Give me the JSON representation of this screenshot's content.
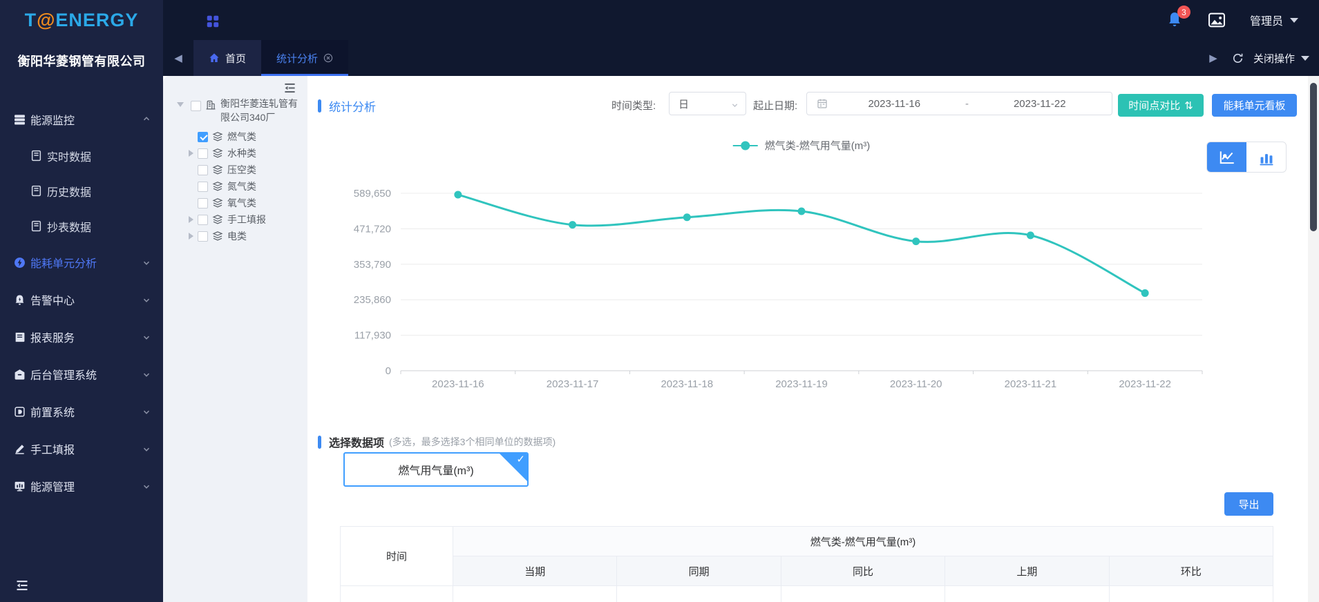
{
  "header": {
    "logo": {
      "t": "T",
      "at": "@",
      "rest": "ENERGY"
    },
    "company": "衡阳华菱钢管有限公司",
    "notification_badge": "3",
    "user": "管理员"
  },
  "tabbar": {
    "home_tab": "首页",
    "active_tab": "统计分析",
    "close_action": "关闭操作"
  },
  "sidebar": {
    "items": [
      {
        "label": "能源监控",
        "icon": "server-icon",
        "expanded": true,
        "active": false,
        "children": [
          {
            "label": "实时数据",
            "icon": "book-icon"
          },
          {
            "label": "历史数据",
            "icon": "book-icon"
          },
          {
            "label": "抄表数据",
            "icon": "book-icon"
          }
        ]
      },
      {
        "label": "能耗单元分析",
        "icon": "bolt-circle-icon",
        "expanded": false,
        "active": true,
        "children": []
      },
      {
        "label": "告警中心",
        "icon": "alarm-bell-icon",
        "expanded": false,
        "active": false,
        "children": []
      },
      {
        "label": "报表服务",
        "icon": "report-icon",
        "expanded": false,
        "active": false,
        "children": []
      },
      {
        "label": "后台管理系统",
        "icon": "safe-icon",
        "expanded": false,
        "active": false,
        "children": []
      },
      {
        "label": "前置系统",
        "icon": "front-system-icon",
        "expanded": false,
        "active": false,
        "children": []
      },
      {
        "label": "手工填报",
        "icon": "pencil-icon",
        "expanded": false,
        "active": false,
        "children": []
      },
      {
        "label": "能源管理",
        "icon": "monitor-chart-icon",
        "expanded": false,
        "active": false,
        "children": []
      }
    ]
  },
  "tree": {
    "root": {
      "label": "衡阳华菱连轧管有限公司340厂",
      "icon": "building-icon",
      "checked": false
    },
    "nodes": [
      {
        "label": "燃气类",
        "checked": true,
        "caret": "none"
      },
      {
        "label": "水种类",
        "checked": false,
        "caret": "right"
      },
      {
        "label": "压空类",
        "checked": false,
        "caret": "none"
      },
      {
        "label": "氮气类",
        "checked": false,
        "caret": "none"
      },
      {
        "label": "氧气类",
        "checked": false,
        "caret": "none"
      },
      {
        "label": "手工填报",
        "checked": false,
        "caret": "right"
      },
      {
        "label": "电类",
        "checked": false,
        "caret": "right"
      }
    ]
  },
  "toolbar": {
    "section_title": "统计分析",
    "time_type_label": "时间类型:",
    "time_type_value": "日",
    "date_range_label": "起止日期:",
    "date_start": "2023-11-16",
    "date_separator": "-",
    "date_end": "2023-11-22",
    "compare_button": "时间点对比",
    "compare_icon": "⇅",
    "board_button": "能耗单元看板"
  },
  "chart_data": {
    "type": "line",
    "smooth": true,
    "grid": true,
    "legend_position": "top-center",
    "x": [
      "2023-11-16",
      "2023-11-17",
      "2023-11-18",
      "2023-11-19",
      "2023-11-20",
      "2023-11-21",
      "2023-11-22"
    ],
    "series": [
      {
        "name": "燃气类-燃气用气量(m³)",
        "values": [
          585000,
          485000,
          510000,
          530000,
          430000,
          450000,
          258000
        ],
        "color": "#30c4be"
      }
    ],
    "ylim": [
      0,
      589650
    ],
    "yticks": [
      0,
      117930,
      235860,
      353790,
      471720,
      589650
    ],
    "ytick_labels": [
      "0",
      "117,930",
      "235,860",
      "353,790",
      "471,720",
      "589,650"
    ]
  },
  "selector": {
    "title": "选择数据项",
    "hint": "(多选，最多选择3个相同单位的数据项)",
    "options": [
      {
        "label": "燃气用气量(m³)",
        "selected": true
      }
    ]
  },
  "export_button": "导出",
  "table": {
    "time_col": "时间",
    "group_header": "燃气类-燃气用气量(m³)",
    "sub_headers": [
      "当期",
      "同期",
      "同比",
      "上期",
      "环比"
    ]
  },
  "colors": {
    "accent_blue": "#3d8af2",
    "teal_button": "#2cc2b4",
    "chart_line": "#30c4be",
    "badge_red": "#f25555",
    "sidebar_bg": "#1b2341",
    "header_bg": "#10182f",
    "active_menu": "#4f78f6"
  }
}
